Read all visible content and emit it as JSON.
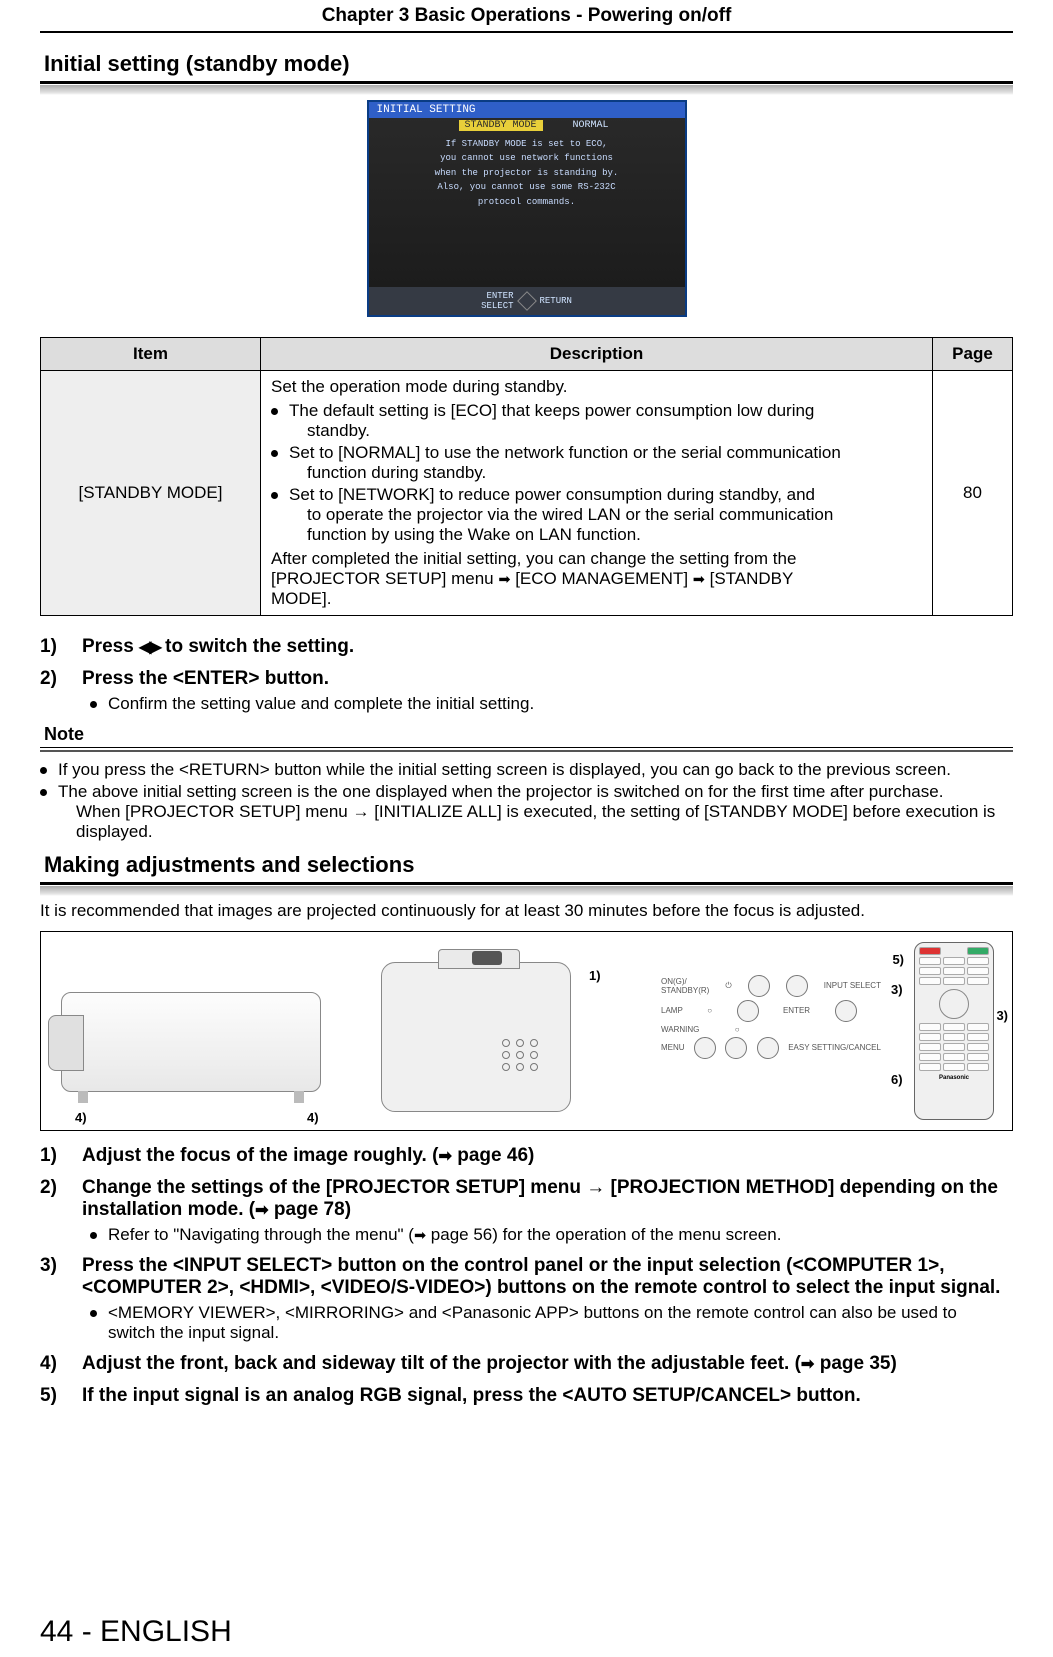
{
  "header": {
    "chapter": "Chapter 3   Basic Operations - Powering on/off"
  },
  "section1": {
    "title": "Initial setting (standby mode)"
  },
  "osd": {
    "title": "INITIAL SETTING",
    "item_label": "STANDBY MODE",
    "item_value": "NORMAL",
    "msg_line1": "If STANDBY MODE is set to ECO,",
    "msg_line2": "you cannot use network functions",
    "msg_line3": "when the projector is standing by.",
    "msg_line4": "Also, you cannot use some RS-232C",
    "msg_line5": "protocol commands.",
    "footer_left": "ENTER",
    "footer_left2": "SELECT",
    "footer_right": "RETURN"
  },
  "table": {
    "head_item": "Item",
    "head_desc": "Description",
    "head_page": "Page",
    "row_item": "[STANDBY MODE]",
    "row_page": "80",
    "desc_intro": "Set the operation mode during standby.",
    "bullet1a": "The default setting is [ECO] that keeps power consumption low during",
    "bullet1b": "standby.",
    "bullet2a": "Set to [NORMAL] to use the network function or the serial communication",
    "bullet2b": "function during standby.",
    "bullet3a": "Set to [NETWORK] to reduce power consumption during standby, and",
    "bullet3b": "to operate the projector via the wired LAN or the serial communication",
    "bullet3c": "function by using the Wake on LAN function.",
    "desc_outro1": "After completed the initial setting, you can change the setting from the",
    "desc_outro2": "[PROJECTOR SETUP] menu ",
    "desc_outro3": " [ECO MANAGEMENT] ",
    "desc_outro4": " [STANDBY",
    "desc_outro5": "MODE]."
  },
  "steps_a": {
    "n1": "1)",
    "t1a": "Press ",
    "t1b": " to switch the setting.",
    "n2": "2)",
    "t2": "Press the <ENTER> button.",
    "s2": "Confirm the setting value and complete the initial setting."
  },
  "note": {
    "heading": "Note",
    "b1": "If you press the <RETURN> button while the initial setting screen is displayed, you can go back to the previous screen.",
    "b2a": "The above initial setting screen is the one displayed when the projector is switched on for the first time after purchase.",
    "b2b": "When [PROJECTOR SETUP] menu → [INITIALIZE ALL] is executed, the setting of [STANDBY MODE] before execution is",
    "b2c": "displayed."
  },
  "section2": {
    "title": "Making adjustments and selections",
    "intro": "It is recommended that images are projected continuously for at least 30 minutes before the focus is adjusted."
  },
  "diagram": {
    "l1": "1)",
    "l3a": "3)",
    "l3b": "3)",
    "l4a": "4)",
    "l4b": "4)",
    "l5": "5)",
    "l6": "6)",
    "cp_standby": "ON(G)/\nSTANDBY(R)",
    "cp_input": "INPUT SELECT",
    "cp_lamp": "LAMP",
    "cp_enter": "ENTER",
    "cp_warning": "WARNING",
    "cp_menu": "MENU",
    "cp_easy": "EASY SETTING/CANCEL",
    "remote_brand": "Panasonic"
  },
  "steps_b": {
    "n1": "1)",
    "t1a": "Adjust the focus of the image roughly. (",
    "t1b": " page 46)",
    "n2": "2)",
    "t2a": "Change the settings of the [PROJECTOR SETUP] menu → [PROJECTION METHOD] depending on the",
    "t2b": "installation mode. (",
    "t2c": " page 78)",
    "s2a": "Refer to \"Navigating through the menu\" (",
    "s2b": " page 56) for the operation of the menu screen.",
    "n3": "3)",
    "t3a": "Press the <INPUT SELECT> button on the control panel or the input selection (<COMPUTER 1>,",
    "t3b": "<COMPUTER 2>, <HDMI>, <VIDEO/S-VIDEO>) buttons on the remote control to select the input signal.",
    "s3a": "<MEMORY VIEWER>, <MIRRORING> and <Panasonic APP> buttons on the remote control can also be used to",
    "s3b": "switch the input signal.",
    "n4": "4)",
    "t4a": "Adjust the front, back and sideway tilt of the projector with the adjustable feet. (",
    "t4b": " page 35)",
    "n5": "5)",
    "t5": "If the input signal is an analog RGB signal, press the <AUTO SETUP/CANCEL> button."
  },
  "footer": {
    "page": "44 - ENGLISH"
  }
}
